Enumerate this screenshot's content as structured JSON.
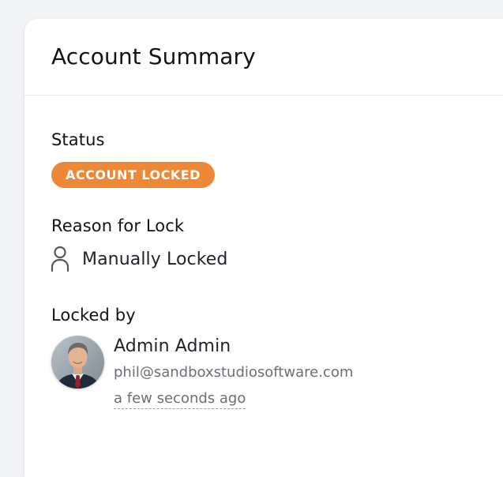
{
  "card": {
    "title": "Account Summary"
  },
  "status": {
    "label": "Status",
    "badge_text": "ACCOUNT LOCKED",
    "badge_color": "#ed8936"
  },
  "reason": {
    "label": "Reason for Lock",
    "icon": "person-icon",
    "value": "Manually Locked"
  },
  "locked_by": {
    "label": "Locked by",
    "avatar": "user-avatar-photo",
    "name": "Admin Admin",
    "email": "phil@sandboxstudiosoftware.com",
    "time": "a few seconds ago"
  }
}
